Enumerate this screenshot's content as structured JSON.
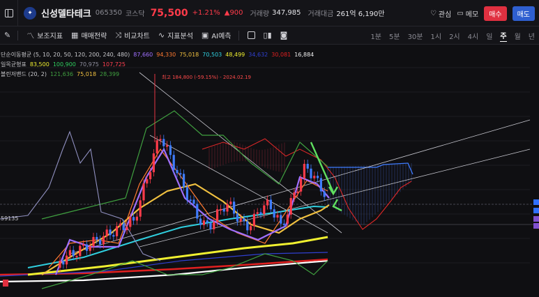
{
  "header": {
    "logo_glyph": "✦",
    "stock_name": "신성델타테크",
    "stock_code": "065350",
    "market": "코스닥",
    "price": "75,500",
    "change_rate": "+1.21%",
    "change_amount": "▲900",
    "volume_label": "거래량",
    "volume_value": "347,985",
    "trade_value_label": "거래대금",
    "trade_value": "261억 6,190만",
    "watch_label": "관심",
    "memo_label": "메모",
    "buy_label": "매수",
    "sell_label": "매도"
  },
  "toolbar": {
    "indicators": "보조지표",
    "strategy": "매매전략",
    "compare": "비교차트",
    "analysis": "지표분석",
    "ai": "AI예측",
    "periods": [
      "1분",
      "5분",
      "30분",
      "1시",
      "2시",
      "4시",
      "일",
      "주",
      "월",
      "년"
    ],
    "active_period": "주"
  },
  "legend": {
    "ma_title": "단순이동평균 (5, 10, 20, 50, 120, 200, 240, 480)",
    "ma_values": [
      {
        "value": "87,660",
        "color": "#a070ff"
      },
      {
        "value": "94,330",
        "color": "#ff7a30"
      },
      {
        "value": "75,018",
        "color": "#f0c040"
      },
      {
        "value": "70,503",
        "color": "#30d0e0"
      },
      {
        "value": "48,499",
        "color": "#f0f030"
      },
      {
        "value": "34,632",
        "color": "#3040d0"
      },
      {
        "value": "30,081",
        "color": "#e02020"
      },
      {
        "value": "16,884",
        "color": "#f0f0f0"
      }
    ],
    "ichimoku_title": "일목균형표",
    "ichimoku_values": [
      {
        "value": "83,500",
        "color": "#f0f030"
      },
      {
        "value": "100,900",
        "color": "#30d060"
      },
      {
        "value": "70,975",
        "color": "#9090a0"
      },
      {
        "value": "107,725",
        "color": "#ff4050"
      }
    ],
    "bollinger_title": "볼린저밴드 (20, 2)",
    "bollinger_values": [
      {
        "value": "121,636",
        "color": "#40a040"
      },
      {
        "value": "75,018",
        "color": "#f0c040"
      },
      {
        "value": "28,399",
        "color": "#40a040"
      }
    ]
  },
  "chart": {
    "high_annotation": "최고 184,800 (-59.15%) - 2024.02.19",
    "left_price_label": "59135"
  },
  "colors": {
    "up": "#ff3b4a",
    "down": "#3f7cff",
    "background": "#0f0f12"
  }
}
